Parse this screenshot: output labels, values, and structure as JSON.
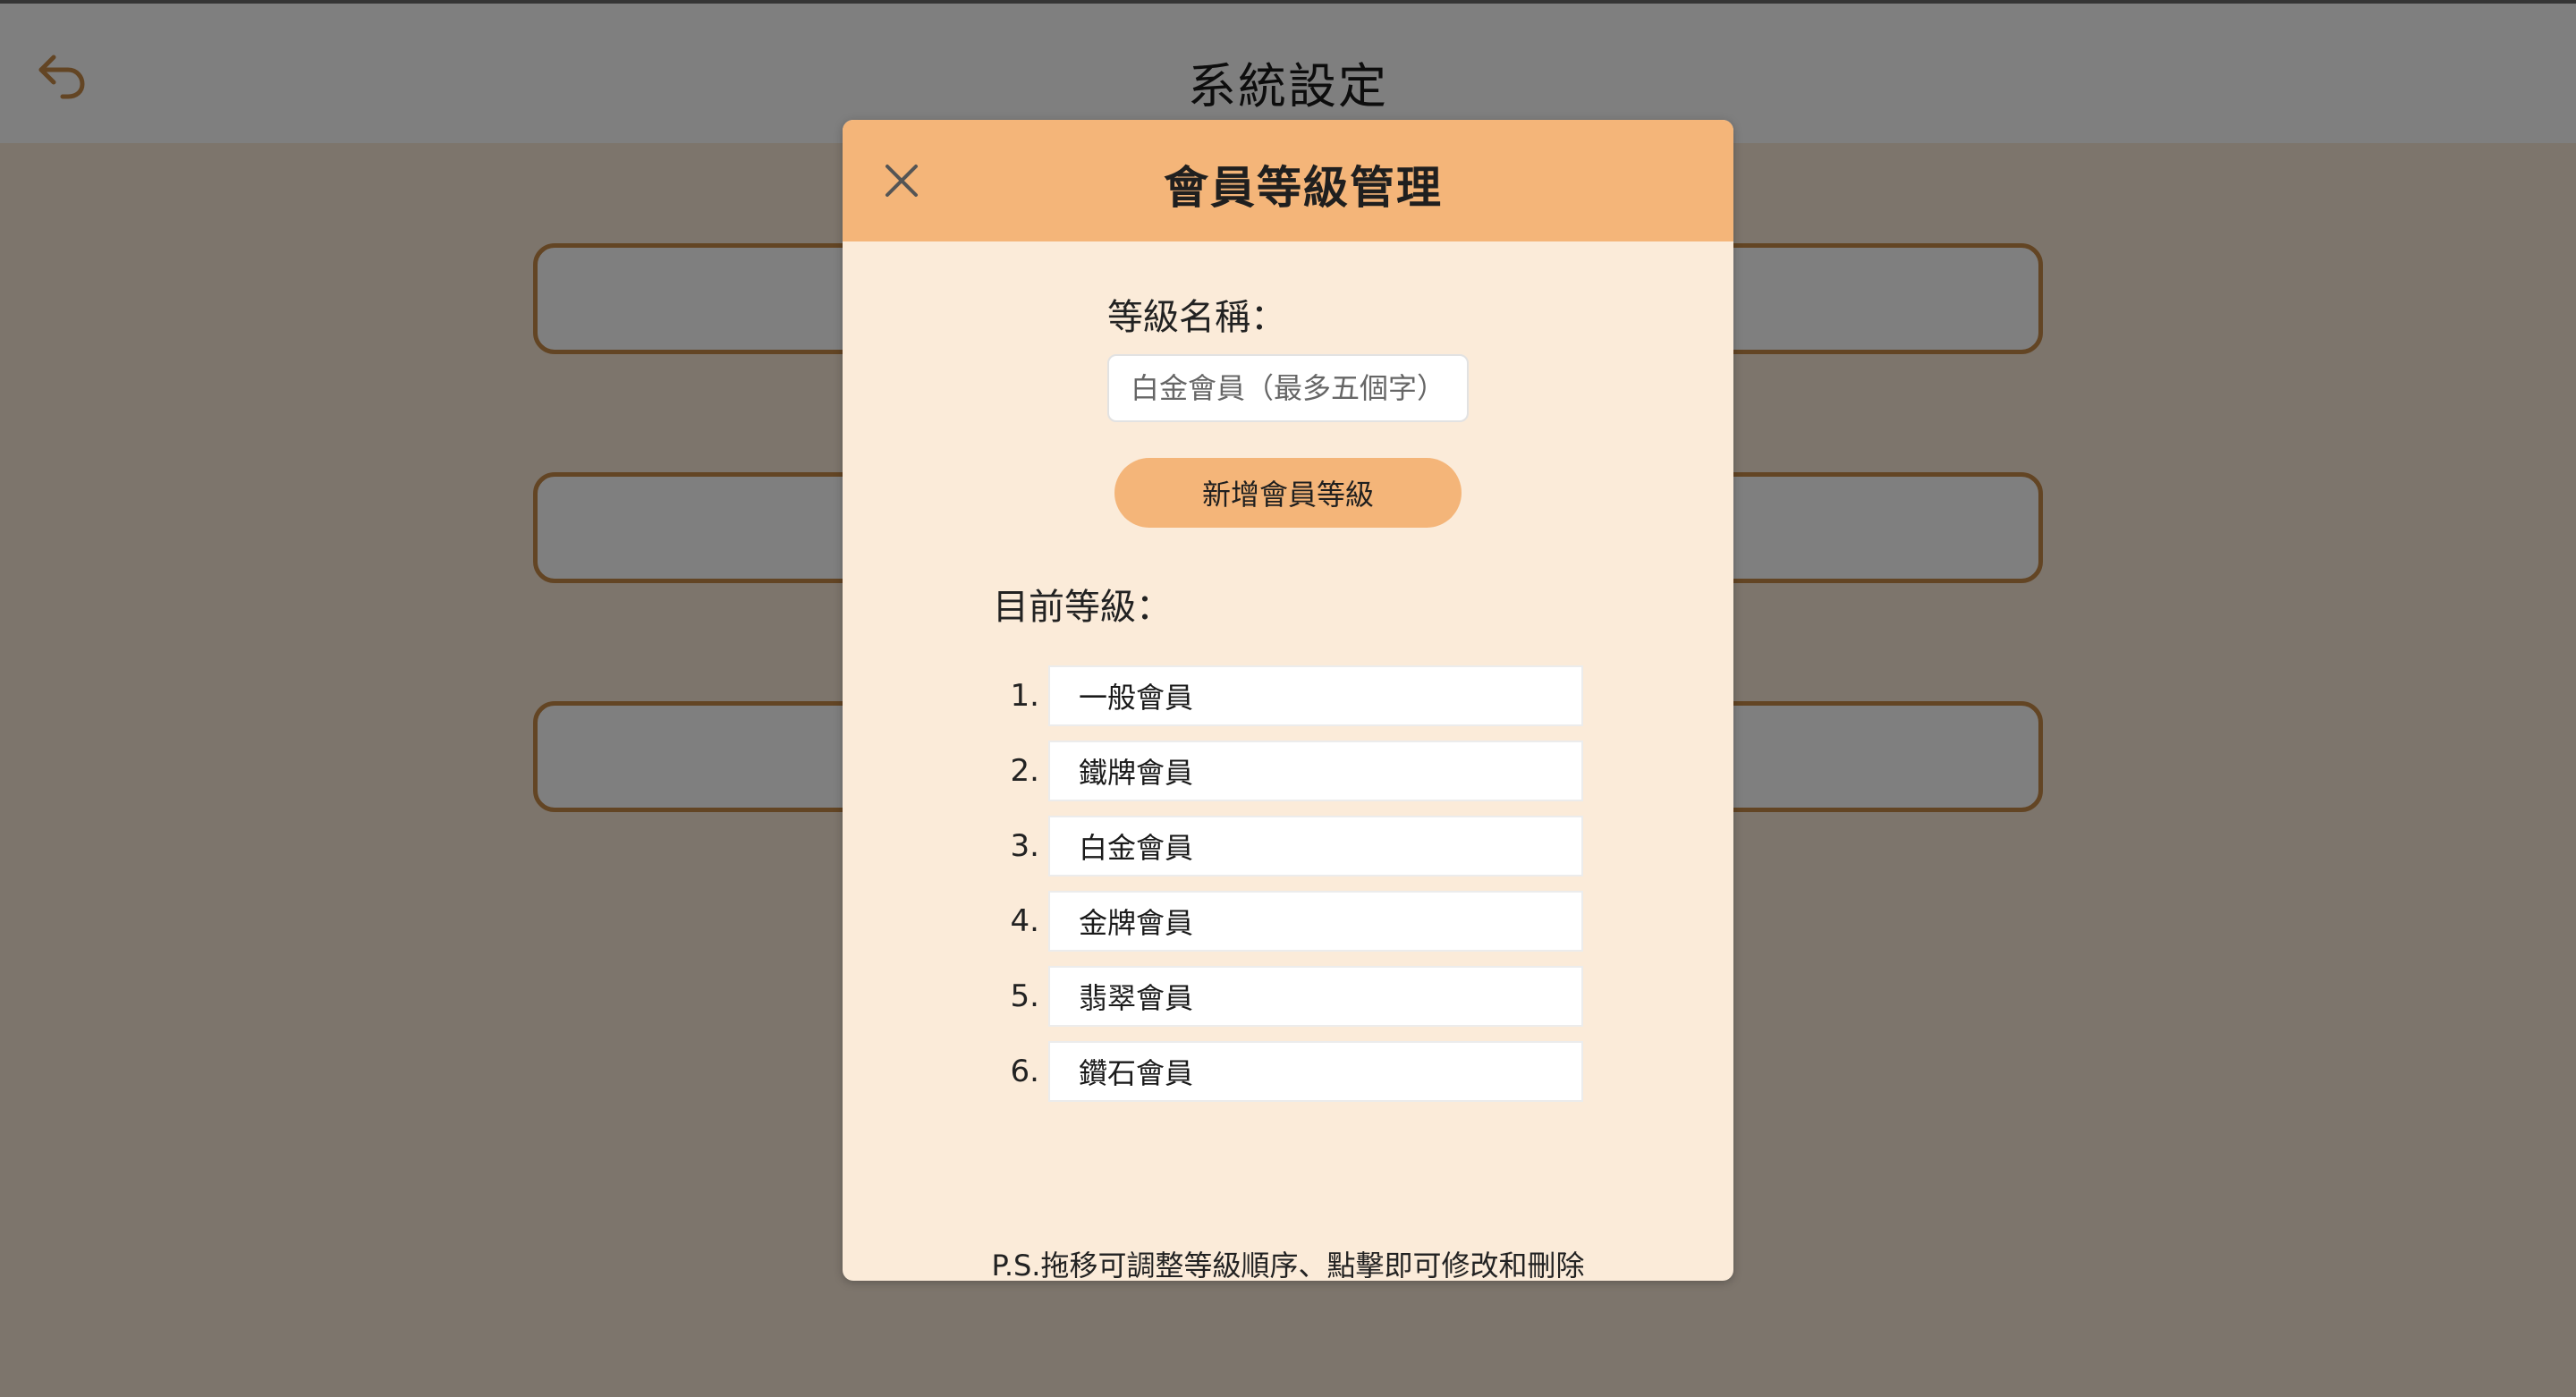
{
  "page": {
    "title": "系統設定",
    "back_icon": "undo-arrow-icon"
  },
  "modal": {
    "title": "會員等級管理",
    "close_icon": "close-icon",
    "name_label": "等級名稱：",
    "name_input_placeholder": "白金會員（最多五個字）",
    "name_input_value": "",
    "add_button_label": "新增會員等級",
    "current_label": "目前等級：",
    "levels": [
      {
        "num": "1.",
        "name": "一般會員"
      },
      {
        "num": "2.",
        "name": "鐵牌會員"
      },
      {
        "num": "3.",
        "name": "白金會員"
      },
      {
        "num": "4.",
        "name": "金牌會員"
      },
      {
        "num": "5.",
        "name": "翡翠會員"
      },
      {
        "num": "6.",
        "name": "鑽石會員"
      }
    ],
    "note": "P.S.拖移可調整等級順序、點擊即可修改和刪除"
  },
  "colors": {
    "accent": "#f4b579",
    "modal_bg": "#fbebd9",
    "border_brown": "#c78a49"
  }
}
